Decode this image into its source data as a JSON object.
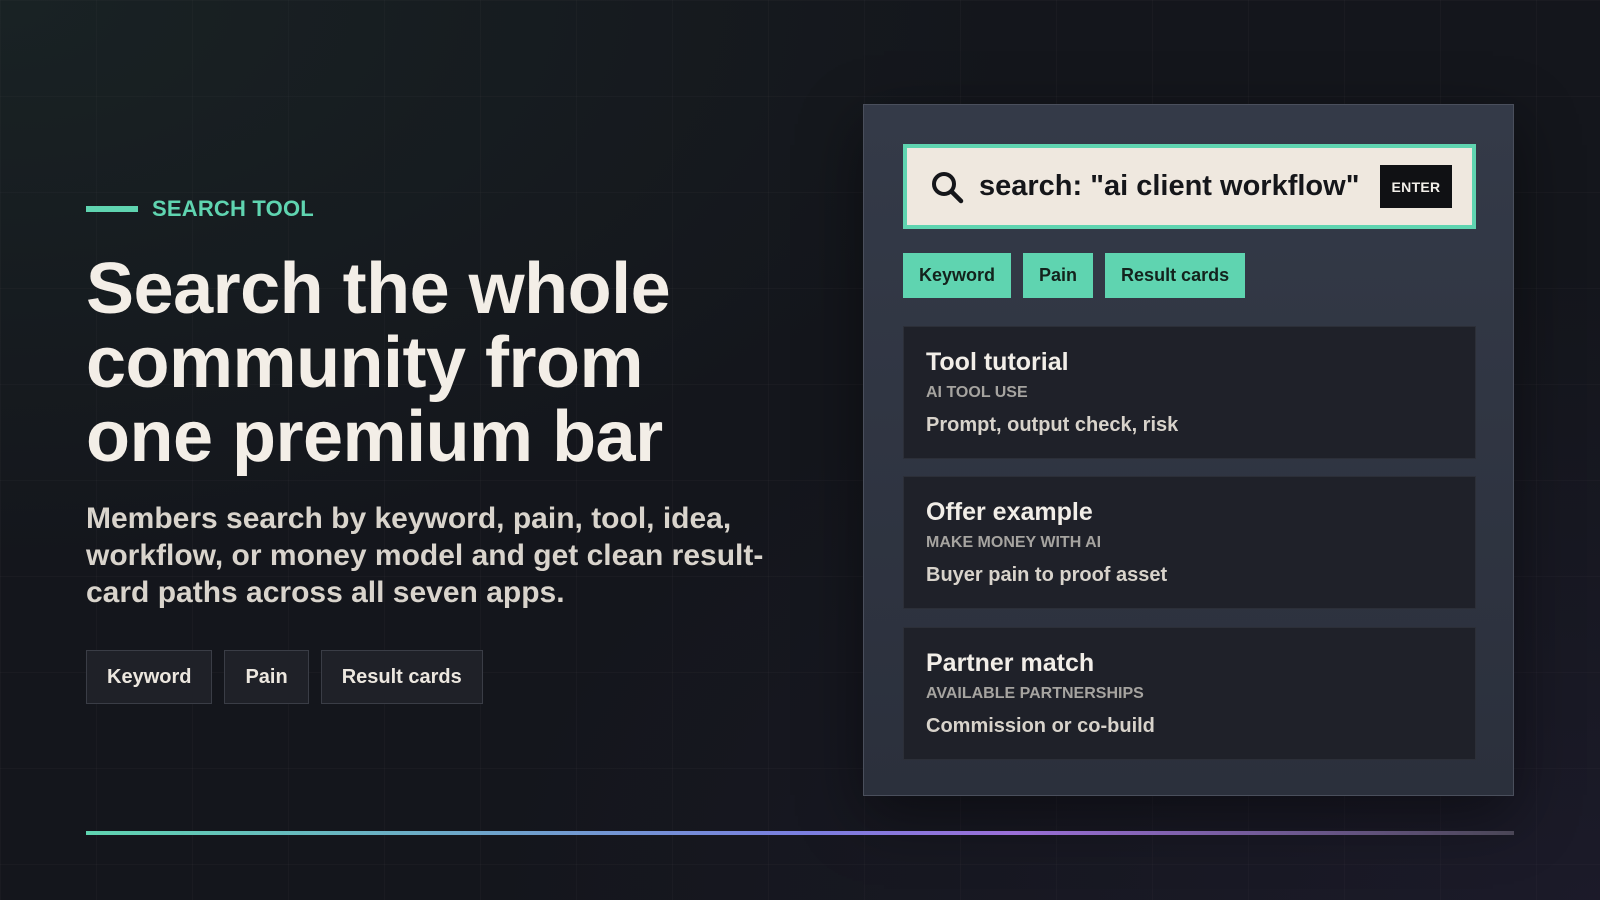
{
  "hero": {
    "eyebrow": "SEARCH TOOL",
    "headline_lines": [
      "Search the whole",
      "community from",
      "one premium bar"
    ],
    "subtext": "Members search by keyword, pain, tool, idea, workflow, or money model and get clean result-card paths across all seven apps.",
    "chips": [
      "Keyword",
      "Pain",
      "Result cards"
    ]
  },
  "search": {
    "query": "search: \"ai client workflow\"",
    "enter_label": "ENTER",
    "icon": "search-icon",
    "filters": [
      "Keyword",
      "Pain",
      "Result cards"
    ]
  },
  "results": [
    {
      "title": "Tool tutorial",
      "category": "AI TOOL USE",
      "description": "Prompt, output check, risk"
    },
    {
      "title": "Offer example",
      "category": "MAKE MONEY WITH AI",
      "description": "Buyer pain to proof asset"
    },
    {
      "title": "Partner match",
      "category": "AVAILABLE PARTNERSHIPS",
      "description": "Commission or co-build"
    }
  ],
  "colors": {
    "accent": "#5fd4b0",
    "background": "#14161c",
    "panel": "#343a48",
    "card": "#1f2129",
    "search_bg": "#efe8df"
  }
}
